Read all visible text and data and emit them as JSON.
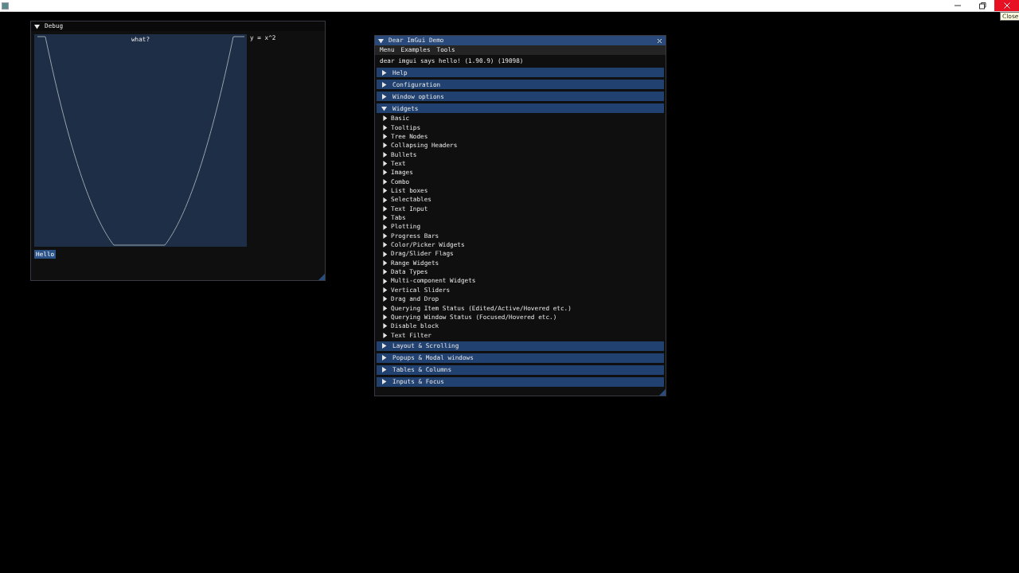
{
  "host_window": {
    "controls": [
      {
        "kind": "minimize"
      },
      {
        "kind": "restore"
      },
      {
        "kind": "close"
      }
    ],
    "tooltip": "Close"
  },
  "debug_window": {
    "title": "Debug",
    "expanded": true,
    "plot": {
      "label": "what?"
    },
    "legend": "y = x^2",
    "buttons": [
      "Hello"
    ]
  },
  "demo_window": {
    "title": "Dear ImGui Demo",
    "expanded": true,
    "menu": [
      "Menu",
      "Examples",
      "Tools"
    ],
    "text": "dear imgui says hello! (1.90.9) (19098)",
    "sections": [
      {
        "label": "Help",
        "expanded": false
      },
      {
        "label": "Configuration",
        "expanded": false
      },
      {
        "label": "Window options",
        "expanded": false
      },
      {
        "label": "Widgets",
        "expanded": true,
        "children": [
          {
            "label": "Basic",
            "expanded": false
          },
          {
            "label": "Tooltips",
            "expanded": false
          },
          {
            "label": "Tree Nodes",
            "expanded": false
          },
          {
            "label": "Collapsing Headers",
            "expanded": false
          },
          {
            "label": "Bullets",
            "expanded": false
          },
          {
            "label": "Text",
            "expanded": false
          },
          {
            "label": "Images",
            "expanded": false
          },
          {
            "label": "Combo",
            "expanded": false
          },
          {
            "label": "List boxes",
            "expanded": false
          },
          {
            "label": "Selectables",
            "expanded": false
          },
          {
            "label": "Text Input",
            "expanded": false
          },
          {
            "label": "Tabs",
            "expanded": false
          },
          {
            "label": "Plotting",
            "expanded": false
          },
          {
            "label": "Progress Bars",
            "expanded": false
          },
          {
            "label": "Color/Picker Widgets",
            "expanded": false
          },
          {
            "label": "Drag/Slider Flags",
            "expanded": false
          },
          {
            "label": "Range Widgets",
            "expanded": false
          },
          {
            "label": "Data Types",
            "expanded": false
          },
          {
            "label": "Multi-component Widgets",
            "expanded": false
          },
          {
            "label": "Vertical Sliders",
            "expanded": false
          },
          {
            "label": "Drag and Drop",
            "expanded": false
          },
          {
            "label": "Querying Item Status (Edited/Active/Hovered etc.)",
            "expanded": false
          },
          {
            "label": "Querying Window Status (Focused/Hovered etc.)",
            "expanded": false
          },
          {
            "label": "Disable block",
            "expanded": false
          },
          {
            "label": "Text Filter",
            "expanded": false
          }
        ]
      },
      {
        "label": "Layout & Scrolling",
        "expanded": false
      },
      {
        "label": "Popups & Modal windows",
        "expanded": false
      },
      {
        "label": "Tables & Columns",
        "expanded": false
      },
      {
        "label": "Inputs & Focus",
        "expanded": false
      }
    ]
  }
}
